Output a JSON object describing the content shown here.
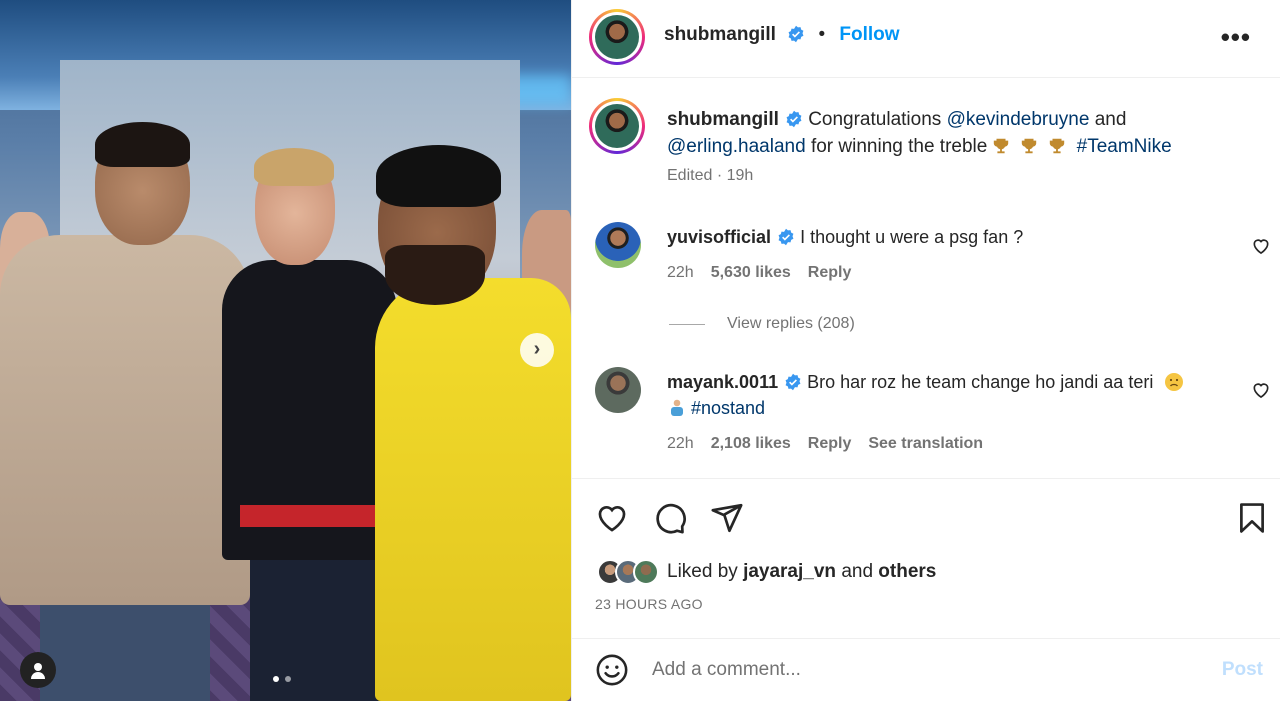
{
  "post": {
    "author": "shubmangill",
    "follow_label": "Follow",
    "separator": "•",
    "more_label": "•••",
    "caption": {
      "text_1": "Congratulations",
      "mention_1": "@kevindebruyne",
      "text_2": "and",
      "mention_2": "@erling.haaland",
      "text_3": "for winning the treble",
      "hashtag": "#TeamNike",
      "edited_label": "Edited",
      "dot": "·",
      "age": "19h"
    },
    "image_dots": 2,
    "active_dot": 0
  },
  "comments": [
    {
      "user": "yuvisofficial",
      "text": "I thought u were a psg fan ?",
      "age": "22h",
      "likes": "5,630 likes",
      "reply_label": "Reply",
      "view_replies": "View replies (208)"
    },
    {
      "user": "mayank.0011",
      "text": "Bro har roz he team change ho jandi aa teri",
      "hashtag": "#nostand",
      "age": "22h",
      "likes": "2,108 likes",
      "reply_label": "Reply",
      "translation_label": "See translation"
    }
  ],
  "likes_row": {
    "prefix": "Liked by",
    "user": "jayaraj_vn",
    "mid": "and",
    "others": "others"
  },
  "timestamp": "23 HOURS AGO",
  "add_comment": {
    "placeholder": "Add a comment...",
    "post_label": "Post"
  },
  "colors": {
    "accent": "#0095f6",
    "mention": "#00376b",
    "muted": "#737373",
    "verified": "#3897f0"
  },
  "icons": [
    "heart-icon",
    "comment-icon",
    "share-icon",
    "bookmark-icon",
    "emoji-icon",
    "verified-icon",
    "trophy-icon",
    "chevron-right-icon",
    "user-tag-icon"
  ]
}
